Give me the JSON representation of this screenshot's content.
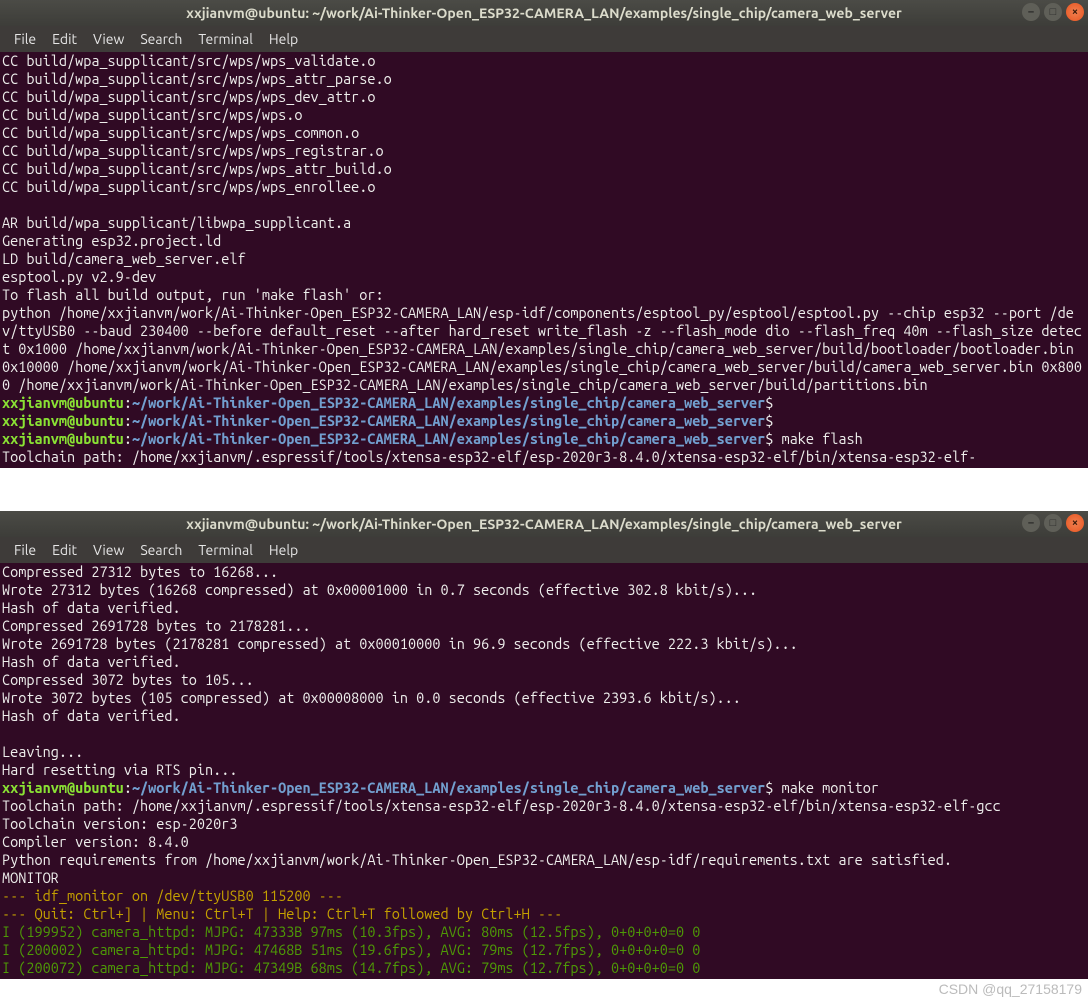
{
  "window1": {
    "title": "xxjianvm@ubuntu: ~/work/Ai-Thinker-Open_ESP32-CAMERA_LAN/examples/single_chip/camera_web_server",
    "menu": {
      "file": "File",
      "edit": "Edit",
      "view": "View",
      "search": "Search",
      "terminal": "Terminal",
      "help": "Help"
    },
    "build_lines": [
      "CC build/wpa_supplicant/src/wps/wps_validate.o",
      "CC build/wpa_supplicant/src/wps/wps_attr_parse.o",
      "CC build/wpa_supplicant/src/wps/wps_dev_attr.o",
      "CC build/wpa_supplicant/src/wps/wps.o",
      "CC build/wpa_supplicant/src/wps/wps_common.o",
      "CC build/wpa_supplicant/src/wps/wps_registrar.o",
      "CC build/wpa_supplicant/src/wps/wps_attr_build.o",
      "CC build/wpa_supplicant/src/wps/wps_enrollee.o",
      "",
      "AR build/wpa_supplicant/libwpa_supplicant.a",
      "Generating esp32.project.ld",
      "LD build/camera_web_server.elf",
      "esptool.py v2.9-dev",
      "To flash all build output, run 'make flash' or:"
    ],
    "flash_cmd": "python /home/xxjianvm/work/Ai-Thinker-Open_ESP32-CAMERA_LAN/esp-idf/components/esptool_py/esptool/esptool.py --chip esp32 --port /dev/ttyUSB0 --baud 230400 --before default_reset --after hard_reset write_flash -z --flash_mode dio --flash_freq 40m --flash_size detect 0x1000 /home/xxjianvm/work/Ai-Thinker-Open_ESP32-CAMERA_LAN/examples/single_chip/camera_web_server/build/bootloader/bootloader.bin 0x10000 /home/xxjianvm/work/Ai-Thinker-Open_ESP32-CAMERA_LAN/examples/single_chip/camera_web_server/build/camera_web_server.bin 0x8000 /home/xxjianvm/work/Ai-Thinker-Open_ESP32-CAMERA_LAN/examples/single_chip/camera_web_server/build/partitions.bin",
    "prompt_user": "xxjianvm@ubuntu",
    "prompt_path": "~/work/Ai-Thinker-Open_ESP32-CAMERA_LAN/examples/single_chip/camera_web_server",
    "dollar": "$",
    "cmd_empty1": " ",
    "cmd_empty2": " ",
    "cmd_make_flash": " make flash",
    "toolchain_partial": "Toolchain path: /home/xxjianvm/.espressif/tools/xtensa-esp32-elf/esp-2020r3-8.4.0/xtensa-esp32-elf/bin/xtensa-esp32-elf-"
  },
  "window2": {
    "title": "xxjianvm@ubuntu: ~/work/Ai-Thinker-Open_ESP32-CAMERA_LAN/examples/single_chip/camera_web_server",
    "menu": {
      "file": "File",
      "edit": "Edit",
      "view": "View",
      "search": "Search",
      "terminal": "Terminal",
      "help": "Help"
    },
    "flash_lines": [
      "Compressed 27312 bytes to 16268...",
      "Wrote 27312 bytes (16268 compressed) at 0x00001000 in 0.7 seconds (effective 302.8 kbit/s)...",
      "Hash of data verified.",
      "Compressed 2691728 bytes to 2178281...",
      "Wrote 2691728 bytes (2178281 compressed) at 0x00010000 in 96.9 seconds (effective 222.3 kbit/s)...",
      "Hash of data verified.",
      "Compressed 3072 bytes to 105...",
      "Wrote 3072 bytes (105 compressed) at 0x00008000 in 0.0 seconds (effective 2393.6 kbit/s)...",
      "Hash of data verified.",
      "",
      "Leaving...",
      "Hard resetting via RTS pin..."
    ],
    "prompt_user": "xxjianvm@ubuntu",
    "prompt_path": "~/work/Ai-Thinker-Open_ESP32-CAMERA_LAN/examples/single_chip/camera_web_server",
    "dollar": "$",
    "cmd_make_monitor": " make monitor",
    "after_lines": [
      "Toolchain path: /home/xxjianvm/.espressif/tools/xtensa-esp32-elf/esp-2020r3-8.4.0/xtensa-esp32-elf/bin/xtensa-esp32-elf-gcc",
      "Toolchain version: esp-2020r3",
      "Compiler version: 8.4.0",
      "Python requirements from /home/xxjianvm/work/Ai-Thinker-Open_ESP32-CAMERA_LAN/esp-idf/requirements.txt are satisfied.",
      "MONITOR"
    ],
    "idf1": "--- idf_monitor on /dev/ttyUSB0 115200 ---",
    "idf2": "--- Quit: Ctrl+] | Menu: Ctrl+T | Help: Ctrl+T followed by Ctrl+H ---",
    "log_lines": [
      "I (199952) camera_httpd: MJPG: 47333B 97ms (10.3fps), AVG: 80ms (12.5fps), 0+0+0+0=0 0",
      "I (200002) camera_httpd: MJPG: 47468B 51ms (19.6fps), AVG: 79ms (12.7fps), 0+0+0+0=0 0",
      "I (200072) camera_httpd: MJPG: 47349B 68ms (14.7fps), AVG: 79ms (12.7fps), 0+0+0+0=0 0"
    ]
  },
  "watermark": "CSDN @qq_27158179"
}
